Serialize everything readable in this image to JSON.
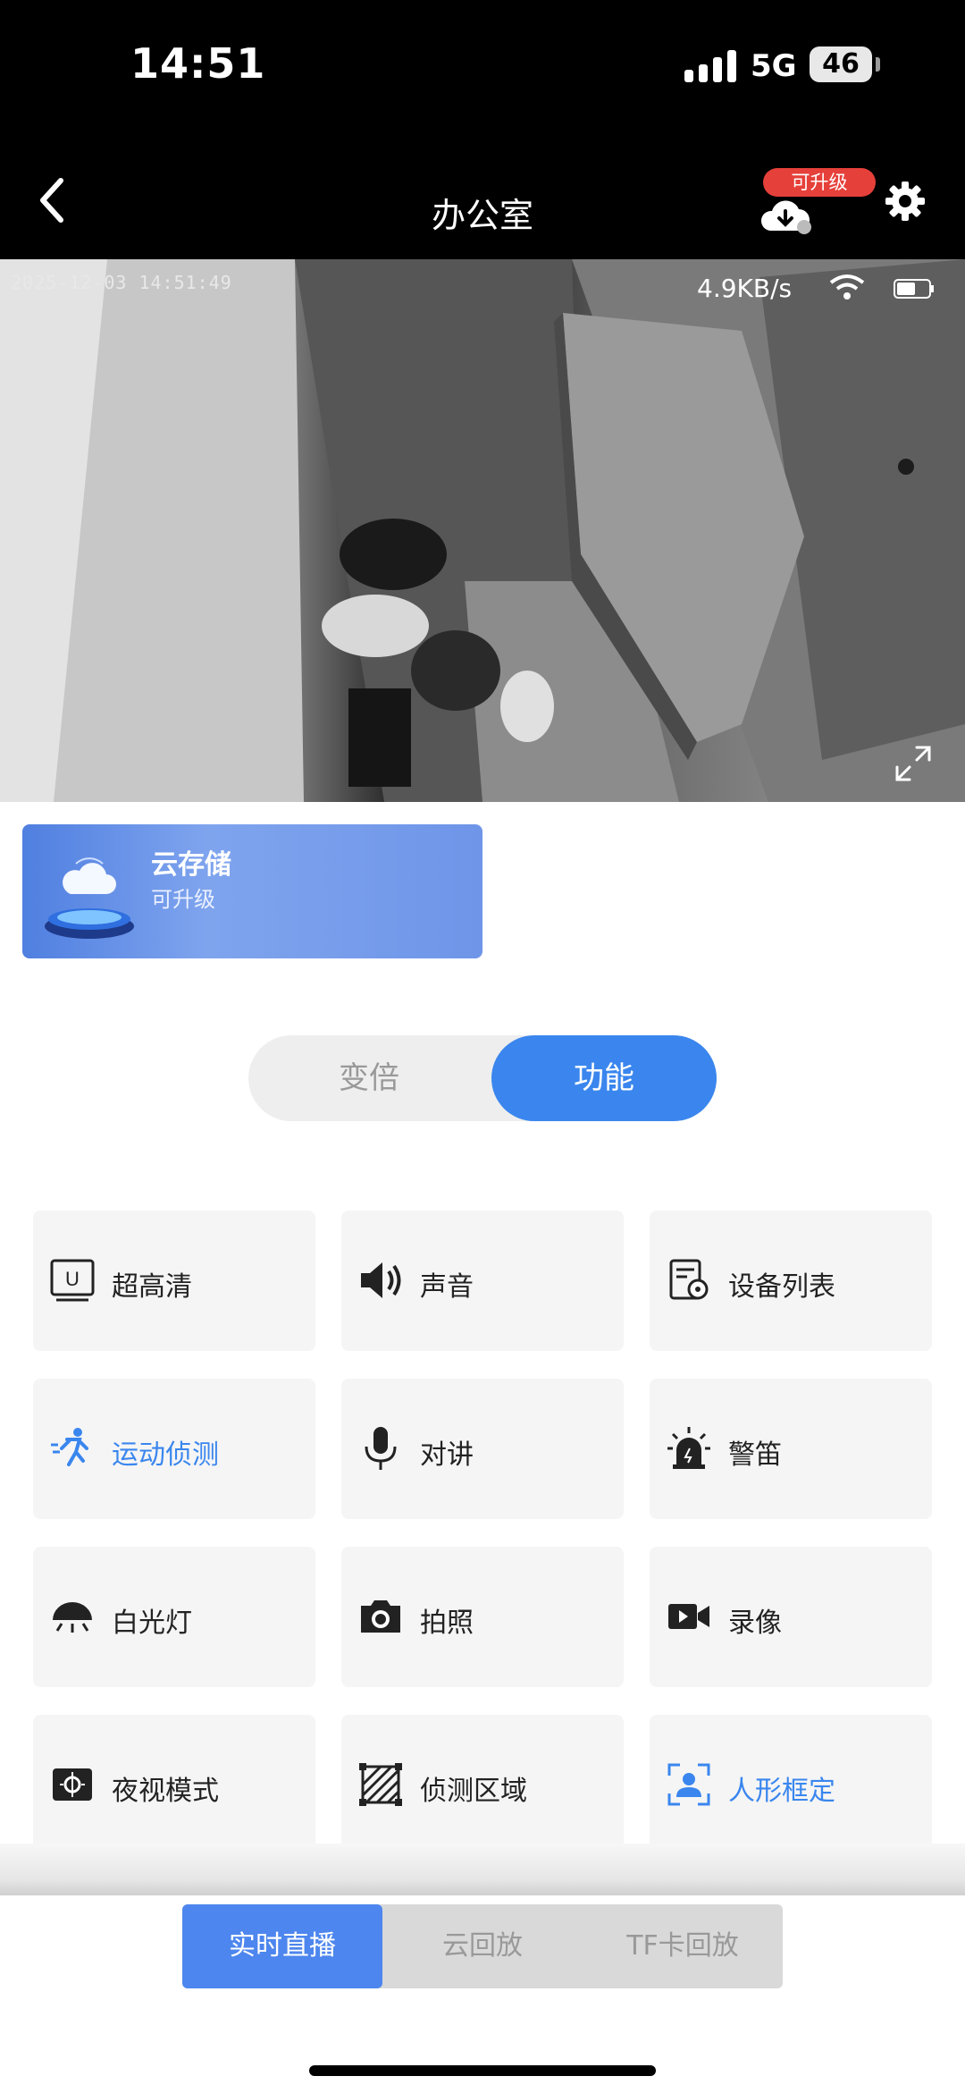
{
  "status_bar": {
    "time": "14:51",
    "network": "5G",
    "battery": "46"
  },
  "header": {
    "title": "办公室",
    "upgrade_badge": "可升级"
  },
  "video": {
    "timestamp": "2025-12-03 14:51:49",
    "speed": "4.9KB/s"
  },
  "cloud_card": {
    "title": "云存储",
    "subtitle": "可升级"
  },
  "segment": {
    "zoom_label": "变倍",
    "function_label": "功能",
    "selected": "功能"
  },
  "features": [
    {
      "label": "超高清",
      "icon": "uhd-icon"
    },
    {
      "label": "声音",
      "icon": "speaker-icon"
    },
    {
      "label": "设备列表",
      "icon": "device-list-icon"
    },
    {
      "label": "运动侦测",
      "icon": "running-person-icon",
      "active": true
    },
    {
      "label": "对讲",
      "icon": "microphone-icon"
    },
    {
      "label": "警笛",
      "icon": "siren-icon"
    },
    {
      "label": "白光灯",
      "icon": "lamp-icon"
    },
    {
      "label": "拍照",
      "icon": "camera-icon"
    },
    {
      "label": "录像",
      "icon": "video-record-icon"
    },
    {
      "label": "夜视模式",
      "icon": "night-vision-icon"
    },
    {
      "label": "侦测区域",
      "icon": "detection-area-icon"
    },
    {
      "label": "人形框定",
      "icon": "human-frame-icon",
      "active": true
    }
  ],
  "bottom_tabs": [
    {
      "label": "实时直播",
      "active": true
    },
    {
      "label": "云回放",
      "active": false
    },
    {
      "label": "TF卡回放",
      "active": false
    }
  ],
  "colors": {
    "accent": "#3a86ee",
    "badge": "#e6403a",
    "tile_bg": "#f5f5f5"
  }
}
